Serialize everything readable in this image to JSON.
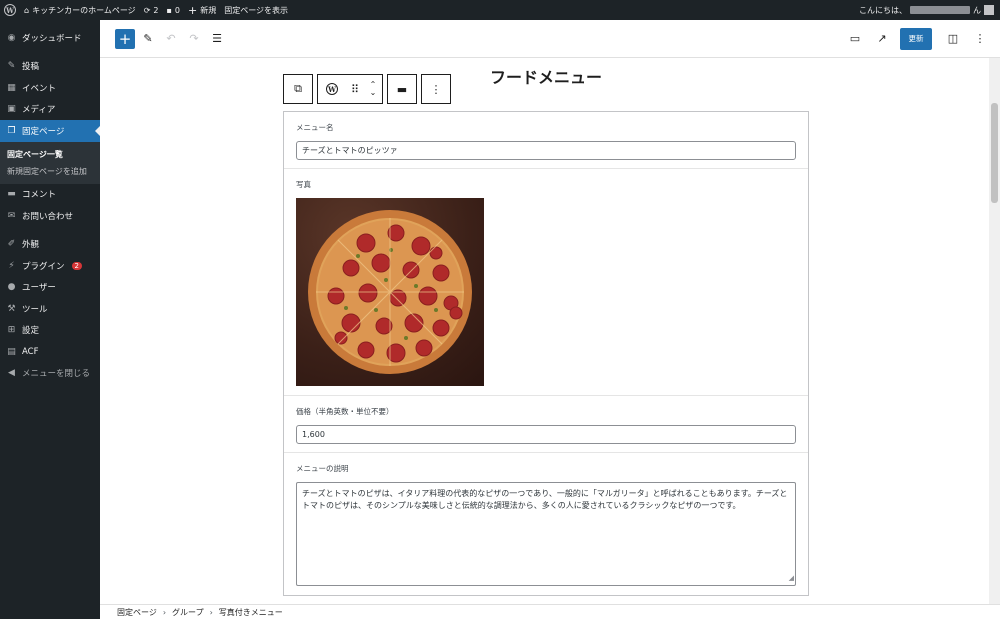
{
  "adminbar": {
    "site_name": "キッチンカーのホームページ",
    "updates_count": "2",
    "comments_count": "0",
    "new_label": "新規",
    "view_page_label": "固定ページを表示",
    "greeting": "こんにちは、",
    "greeting_suffix": "ん"
  },
  "sidebar": {
    "dashboard": "ダッシュボード",
    "posts": "投稿",
    "events": "イベント",
    "media": "メディア",
    "pages": "固定ページ",
    "pages_list": "固定ページ一覧",
    "add_page": "新規固定ページを追加",
    "comments": "コメント",
    "contact": "お問い合わせ",
    "appearance": "外観",
    "plugins": "プラグイン",
    "plugins_badge": "2",
    "users": "ユーザー",
    "tools": "ツール",
    "settings": "設定",
    "acf": "ACF",
    "collapse": "メニューを閉じる"
  },
  "header": {
    "update_label": "更新"
  },
  "page": {
    "title": "フードメニュー"
  },
  "fields": {
    "menu_name_label": "メニュー名",
    "menu_name_value": "チーズとトマトのピッツァ",
    "photo_label": "写真",
    "price_label": "価格（半角英数・単位不要）",
    "price_value": "1,600",
    "description_label": "メニューの説明",
    "description_value": "チーズとトマトのピザは、イタリア料理の代表的なピザの一つであり、一般的に「マルガリータ」と呼ばれることもあります。チーズとトマトのピザは、そのシンプルな美味しさと伝統的な調理法から、多くの人に愛されているクラシックなピザの一つです。"
  },
  "breadcrumb": {
    "items": [
      "固定ページ",
      "グループ",
      "写真付きメニュー"
    ]
  },
  "colors": {
    "admin_dark": "#1d2327",
    "accent": "#2271b1",
    "badge": "#d63638"
  }
}
